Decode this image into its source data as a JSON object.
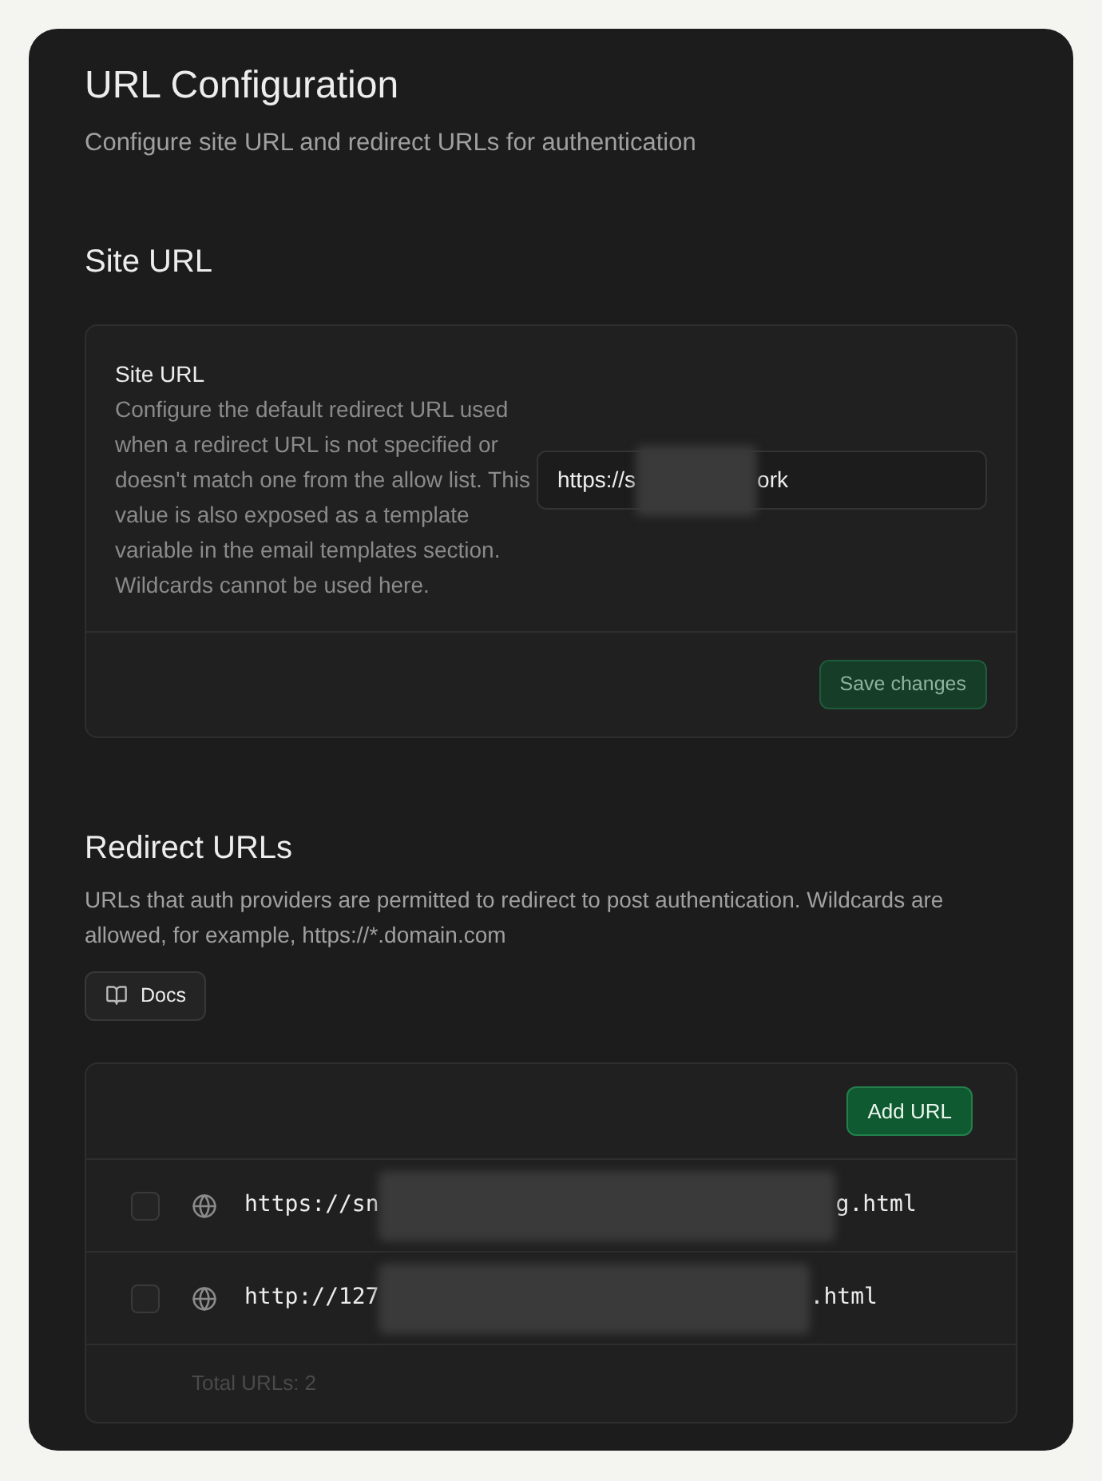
{
  "header": {
    "title": "URL Configuration",
    "subtitle": "Configure site URL and redirect URLs for authentication"
  },
  "site_url": {
    "heading": "Site URL",
    "label": "Site URL",
    "description": "Configure the default redirect URL used when a redirect URL is not specified or doesn't match one from the allow list. This value is also exposed as a template variable in the email templates section. Wildcards cannot be used here.",
    "value_start": "https://s",
    "value_end": "ork",
    "save_button": "Save changes"
  },
  "redirect_urls": {
    "heading": "Redirect URLs",
    "description": "URLs that auth providers are permitted to redirect to post authentication. Wildcards are allowed, for example, https://*.domain.com",
    "docs_button": "Docs",
    "add_button": "Add URL",
    "rows": [
      {
        "url_start": "https://sn",
        "url_end": "g.html",
        "checked": false
      },
      {
        "url_start": "http://127",
        "url_end": ".html",
        "checked": false
      }
    ],
    "total": "Total URLs: 2"
  }
}
